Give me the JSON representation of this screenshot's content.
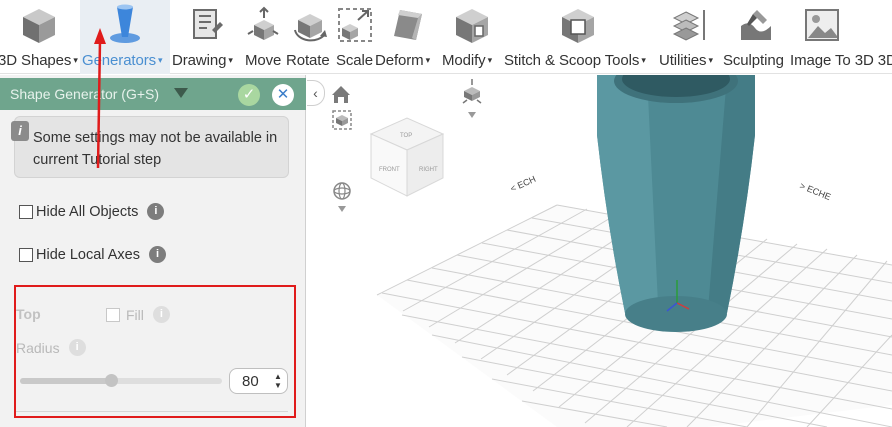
{
  "toolbar": {
    "items": [
      {
        "label": "3D Shapes",
        "icon": "cube-icon"
      },
      {
        "label": "Generators",
        "icon": "generator-icon",
        "active": true
      },
      {
        "label": "Drawing",
        "icon": "drawing-icon"
      },
      {
        "label": "Move",
        "icon": "move-icon"
      },
      {
        "label": "Rotate",
        "icon": "rotate-icon"
      },
      {
        "label": "Scale",
        "icon": "scale-icon"
      },
      {
        "label": "Deform",
        "icon": "deform-icon"
      },
      {
        "label": "Modify",
        "icon": "modify-icon"
      },
      {
        "label": "Stitch & Scoop Tools",
        "icon": "stitch-icon"
      },
      {
        "label": "Utilities",
        "icon": "utilities-icon"
      },
      {
        "label": "Sculpting",
        "icon": "sculpting-icon"
      },
      {
        "label": "Image To 3D",
        "icon": "image-to-3d-icon"
      },
      {
        "label": "3D",
        "icon": ""
      }
    ],
    "caret": "▾"
  },
  "panel": {
    "title": "Shape Generator (G+S)",
    "ok_icon": "✓",
    "close_icon": "✕",
    "info_text": "Some settings may not be available in current Tutorial step",
    "hide_all_objects": "Hide All Objects",
    "hide_local_axes": "Hide Local Axes",
    "top_label": "Top",
    "fill_label": "Fill",
    "radius_label": "Radius",
    "radius_value": "80",
    "radius_fraction": 0.45
  },
  "viewport": {
    "cube_faces": [
      "TOP",
      "FRONT",
      "RIGHT"
    ],
    "axis_label_left": "< ECH",
    "axis_label_right": "> ECHE"
  },
  "colors": {
    "accent": "#4a8fd1",
    "panel_header": "#6fa58d",
    "vase": "#4e8a94",
    "annotation": "#e01b1b"
  }
}
